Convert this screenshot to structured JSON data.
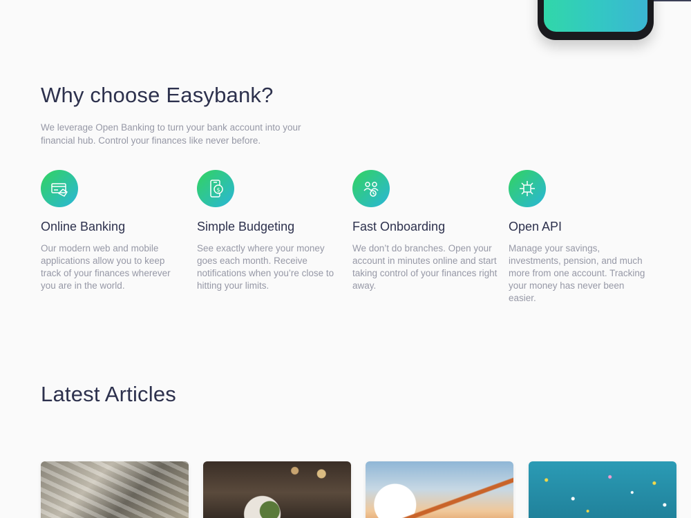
{
  "why": {
    "title": "Why choose Easybank?",
    "description": "We leverage Open Banking to turn your bank account into your financial hub. Control your finances like never before."
  },
  "features": [
    {
      "icon": "online-banking-icon",
      "title": "Online Banking",
      "description": "Our modern web and mobile applications allow you to keep track of your finances wherever you are in the world."
    },
    {
      "icon": "budgeting-icon",
      "title": "Simple Budgeting",
      "description": "See exactly where your money goes each month. Receive notifications when you’re close to hitting your limits."
    },
    {
      "icon": "onboarding-icon",
      "title": "Fast Onboarding",
      "description": "We don’t do branches. Open your account in minutes online and start taking control of your finances right away."
    },
    {
      "icon": "api-icon",
      "title": "Open API",
      "description": "Manage your savings, investments, pension, and much more from one account. Tracking your money has never been easier."
    }
  ],
  "articles": {
    "title": "Latest Articles",
    "items": [
      {
        "image": "currency-image"
      },
      {
        "image": "restaurant-image"
      },
      {
        "image": "plane-image"
      },
      {
        "image": "confetti-image"
      }
    ]
  },
  "colors": {
    "heading": "#2d314d",
    "body": "#9698a6",
    "gradient_start": "#33d35e",
    "gradient_end": "#2ab6d9",
    "background": "#fafafa"
  }
}
